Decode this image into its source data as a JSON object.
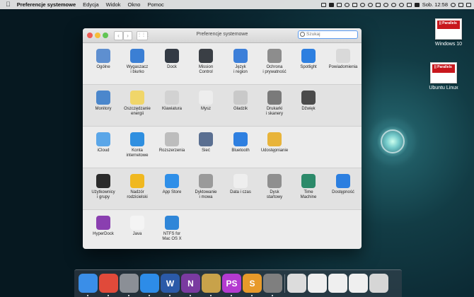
{
  "menubar": {
    "apple": "",
    "app_name": "Preferencje systemowe",
    "items": [
      "Edycja",
      "Widok",
      "Okno",
      "Pomoc"
    ],
    "clock": "Sob. 12:58"
  },
  "desktop_icons": [
    {
      "label": "Windows 10",
      "badge": "|| Parallels"
    },
    {
      "label": "Ubuntu Linux",
      "badge": "|| Parallels"
    }
  ],
  "window": {
    "title": "Preferencje systemowe",
    "search_placeholder": "Szukaj",
    "back": "‹",
    "forward": "›",
    "grid": "⋮⋮⋮"
  },
  "preferences": [
    [
      {
        "label": "Ogólne",
        "icon": "general-icon",
        "color": "#5e8fd0"
      },
      {
        "label": "Wygaszacz\ni biurko",
        "icon": "desktop-screensaver-icon",
        "color": "#3b7fd4"
      },
      {
        "label": "Dock",
        "icon": "dock-icon",
        "color": "#333a44"
      },
      {
        "label": "Mission\nControl",
        "icon": "mission-control-icon",
        "color": "#3a3f45"
      },
      {
        "label": "Język\ni region",
        "icon": "language-region-icon",
        "color": "#3c7fd9"
      },
      {
        "label": "Ochrona\ni prywatność",
        "icon": "security-privacy-icon",
        "color": "#8d8d8d"
      },
      {
        "label": "Spotlight",
        "icon": "spotlight-icon",
        "color": "#2d7fe0"
      },
      {
        "label": "Powiadomienia",
        "icon": "notifications-icon",
        "color": "#d9d9d9"
      }
    ],
    [
      {
        "label": "Monitory",
        "icon": "displays-icon",
        "color": "#4b87cc"
      },
      {
        "label": "Oszczędzanie\nenergii",
        "icon": "energy-saver-icon",
        "color": "#f0d66a"
      },
      {
        "label": "Klawiatura",
        "icon": "keyboard-icon",
        "color": "#d2d2d2"
      },
      {
        "label": "Mysz",
        "icon": "mouse-icon",
        "color": "#ededed"
      },
      {
        "label": "Gładzik",
        "icon": "trackpad-icon",
        "color": "#c9c9c9"
      },
      {
        "label": "Drukarki\ni skanery",
        "icon": "printers-scanners-icon",
        "color": "#7a7a7a"
      },
      {
        "label": "Dźwięk",
        "icon": "sound-icon",
        "color": "#4b4b4b"
      }
    ],
    [
      {
        "label": "iCloud",
        "icon": "icloud-icon",
        "color": "#5aa6e8"
      },
      {
        "label": "Konta\ninternetowe",
        "icon": "internet-accounts-icon",
        "color": "#2f8fe0"
      },
      {
        "label": "Rozszerzenia",
        "icon": "extensions-icon",
        "color": "#bdbdbd"
      },
      {
        "label": "Sieć",
        "icon": "network-icon",
        "color": "#5a6f91"
      },
      {
        "label": "Bluetooth",
        "icon": "bluetooth-icon",
        "color": "#2e7fe0"
      },
      {
        "label": "Udostępnianie",
        "icon": "sharing-icon",
        "color": "#e8b43a"
      }
    ],
    [
      {
        "label": "Użytkownicy\ni grupy",
        "icon": "users-groups-icon",
        "color": "#2b2b2b"
      },
      {
        "label": "Nadzór\nrodzicielski",
        "icon": "parental-controls-icon",
        "color": "#f0b820"
      },
      {
        "label": "App Store",
        "icon": "app-store-icon",
        "color": "#2f8fe8"
      },
      {
        "label": "Dyktowanie\ni mowa",
        "icon": "dictation-speech-icon",
        "color": "#9a9a9a"
      },
      {
        "label": "Data i czas",
        "icon": "date-time-icon",
        "color": "#eeeeee"
      },
      {
        "label": "Dysk\nstartowy",
        "icon": "startup-disk-icon",
        "color": "#8f8f8f"
      },
      {
        "label": "Time\nMachine",
        "icon": "time-machine-icon",
        "color": "#2c8a6a"
      },
      {
        "label": "Dostępność",
        "icon": "accessibility-icon",
        "color": "#2c7fe0"
      }
    ],
    [
      {
        "label": "HyperDock",
        "icon": "hyperdock-icon",
        "color": "#8a3fb0"
      },
      {
        "label": "Java",
        "icon": "java-icon",
        "color": "#f4f4f4"
      },
      {
        "label": "NTFS for\nMac OS X",
        "icon": "ntfs-icon",
        "color": "#2f86d8"
      }
    ]
  ],
  "dock": [
    {
      "name": "finder-icon",
      "color": "#3a8ee8"
    },
    {
      "name": "chrome-icon",
      "color": "#e04a3a"
    },
    {
      "name": "launchpad-icon",
      "color": "#8b8f96"
    },
    {
      "name": "safari-icon",
      "color": "#2d8ce8"
    },
    {
      "name": "word-icon",
      "color": "#2b5aa8",
      "glyph": "W"
    },
    {
      "name": "onenote-icon",
      "color": "#7a3aa0",
      "glyph": "N"
    },
    {
      "name": "archive-utility-icon",
      "color": "#c8a24a"
    },
    {
      "name": "phpstorm-icon",
      "color": "#b43ad0",
      "glyph": "PS"
    },
    {
      "name": "sublime-text-icon",
      "color": "#e79a2a",
      "glyph": "S"
    },
    {
      "name": "system-preferences-icon",
      "color": "#7f7f7f"
    },
    {
      "name": "documents-stack-icon",
      "color": "#dcdcdc"
    },
    {
      "name": "window-thumbnail-icon",
      "color": "#efefef"
    },
    {
      "name": "window-thumbnail-icon",
      "color": "#efefef"
    },
    {
      "name": "window-thumbnail-icon",
      "color": "#efefef"
    },
    {
      "name": "trash-icon",
      "color": "#d6d6d6"
    }
  ]
}
